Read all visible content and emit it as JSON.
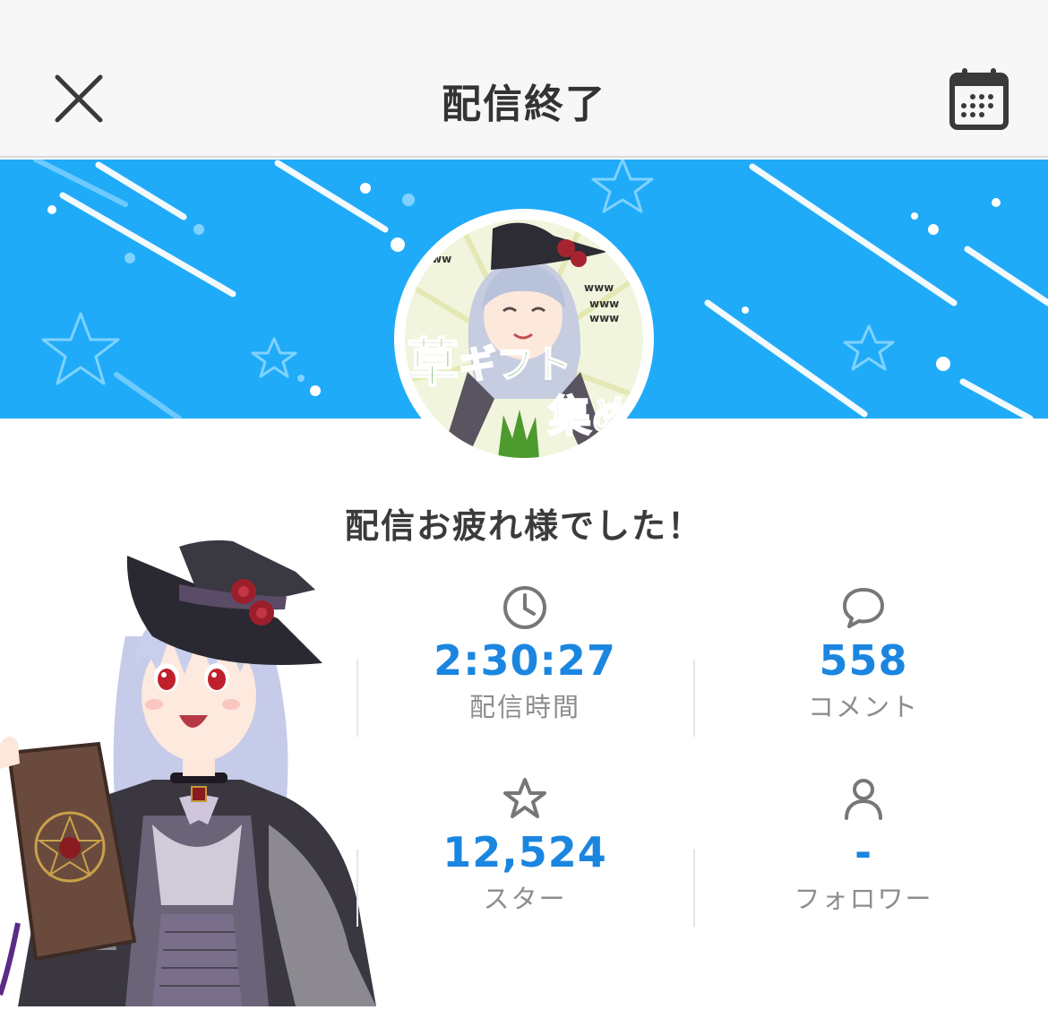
{
  "header": {
    "title": "配信終了"
  },
  "message": "配信お疲れ様でした！",
  "stats": [
    {
      "value": "2:30:27",
      "label": "配信時間",
      "icon": "clock-icon"
    },
    {
      "value": "558",
      "label": "コメント",
      "icon": "comment-icon"
    },
    {
      "value": "12,524",
      "label": "スター",
      "icon": "star-icon"
    },
    {
      "value": "-",
      "label": "フォロワー",
      "icon": "person-icon"
    }
  ],
  "colors": {
    "banner": "#20abf8",
    "accent_value": "#1b86e0",
    "label": "#8d8d8d"
  }
}
